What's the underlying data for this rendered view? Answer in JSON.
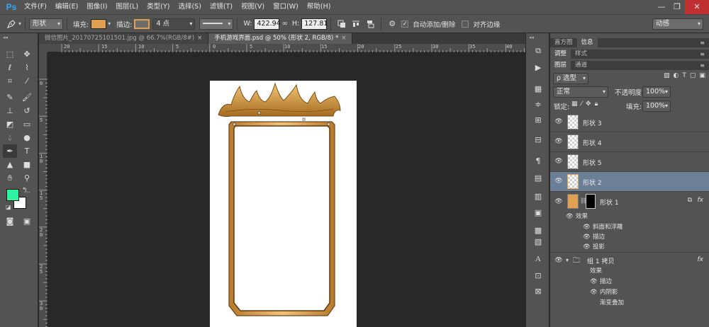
{
  "app": {
    "logo": "Ps"
  },
  "menu": [
    "文件(F)",
    "编辑(E)",
    "图像(I)",
    "图层(L)",
    "类型(Y)",
    "选择(S)",
    "滤镜(T)",
    "视图(V)",
    "窗口(W)",
    "帮助(H)"
  ],
  "window_controls": {
    "minimize": "—",
    "maximize": "❐",
    "close": "✕"
  },
  "options": {
    "tool_mode": "形状",
    "fill_label": "填充:",
    "fill_color": "#e0a050",
    "stroke_label": "描边:",
    "stroke_width": "4 点",
    "w_label": "W:",
    "w_value": "422.94",
    "link_icon": "∞",
    "h_label": "H:",
    "h_value": "127.81",
    "auto_add_delete": "自动添加/删除",
    "align_edges": "对齐边缘",
    "workspace": "动感"
  },
  "doc_tabs": [
    {
      "label": "微信图片_20170725101501.jpg @ 66.7%(RGB/8#)",
      "close": "×"
    },
    {
      "label": "手机游戏界面.psd @ 50% (形状 2, RGB/8) *",
      "close": "×"
    }
  ],
  "ruler_h": [
    "20",
    "15",
    "10",
    "5",
    "0",
    "5",
    "10",
    "15",
    "20",
    "25",
    "30",
    "35",
    "40"
  ],
  "ruler_v": [
    "0",
    "5",
    "1 0",
    "1 5",
    "2 0",
    "2 5",
    "3 0"
  ],
  "colors": {
    "foreground": "#2ef4a0",
    "background": "#ffffff",
    "selected_layer": "#6b7f96"
  },
  "panels": {
    "tabs_top": [
      "直方图",
      "信息"
    ],
    "tabs_mid": [
      "调整",
      "样式"
    ],
    "tabs_layers": [
      "图层",
      "通道"
    ],
    "filter_label": "ρ 选型",
    "blend_mode": "正常",
    "opacity_label": "不透明度:",
    "opacity_value": "100%",
    "lock_label": "锁定:",
    "fill_label": "填充:",
    "fill_value": "100%"
  },
  "layers": [
    {
      "name": "形状 3",
      "selected": false
    },
    {
      "name": "形状 4",
      "selected": false
    },
    {
      "name": "形状 5",
      "selected": false
    },
    {
      "name": "形状 2",
      "selected": true
    }
  ],
  "layer_shape1": {
    "name": "形状 1",
    "fx": "fx",
    "effects_label": "效果",
    "effects": [
      "斜面和浮雕",
      "描边",
      "投影"
    ]
  },
  "group": {
    "name": "组 1 拷贝",
    "fx": "fx",
    "effects_label": "效果",
    "effects": [
      "描边",
      "内阴影",
      "渐变叠加"
    ]
  }
}
